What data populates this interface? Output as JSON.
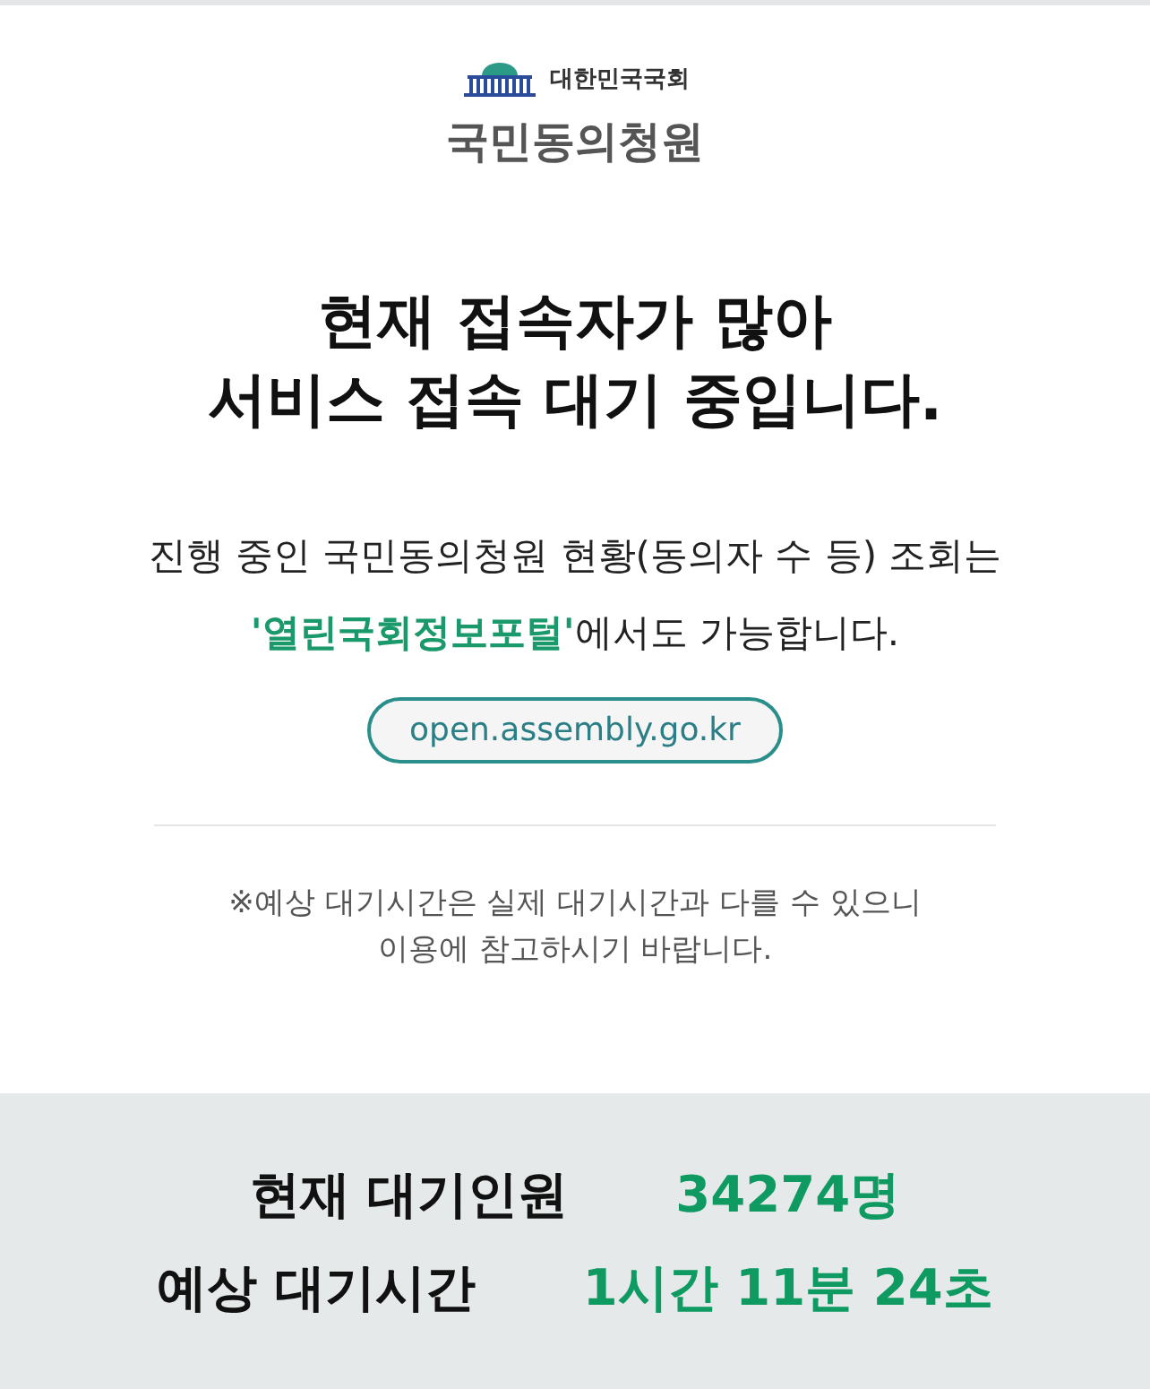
{
  "header": {
    "org": "대한민국국회",
    "service": "국민동의청원"
  },
  "headline": [
    "현재 접속자가 많아",
    "서비스 접속 대기 중입니다."
  ],
  "info": {
    "line1": "진행 중인 국민동의청원 현황(동의자 수 등) 조회는",
    "link": "'열린국회정보포털'",
    "line2_rest": "에서도 가능합니다."
  },
  "portal_button": "open.assembly.go.kr",
  "notice": [
    "※예상 대기시간은 실제 대기시간과 다를 수 있으니",
    "이용에 참고하시기 바랍니다."
  ],
  "stats": [
    {
      "label": "현재 대기인원",
      "value": "34274명"
    },
    {
      "label": "예상 대기시간",
      "value": "1시간 11분 24초"
    }
  ]
}
